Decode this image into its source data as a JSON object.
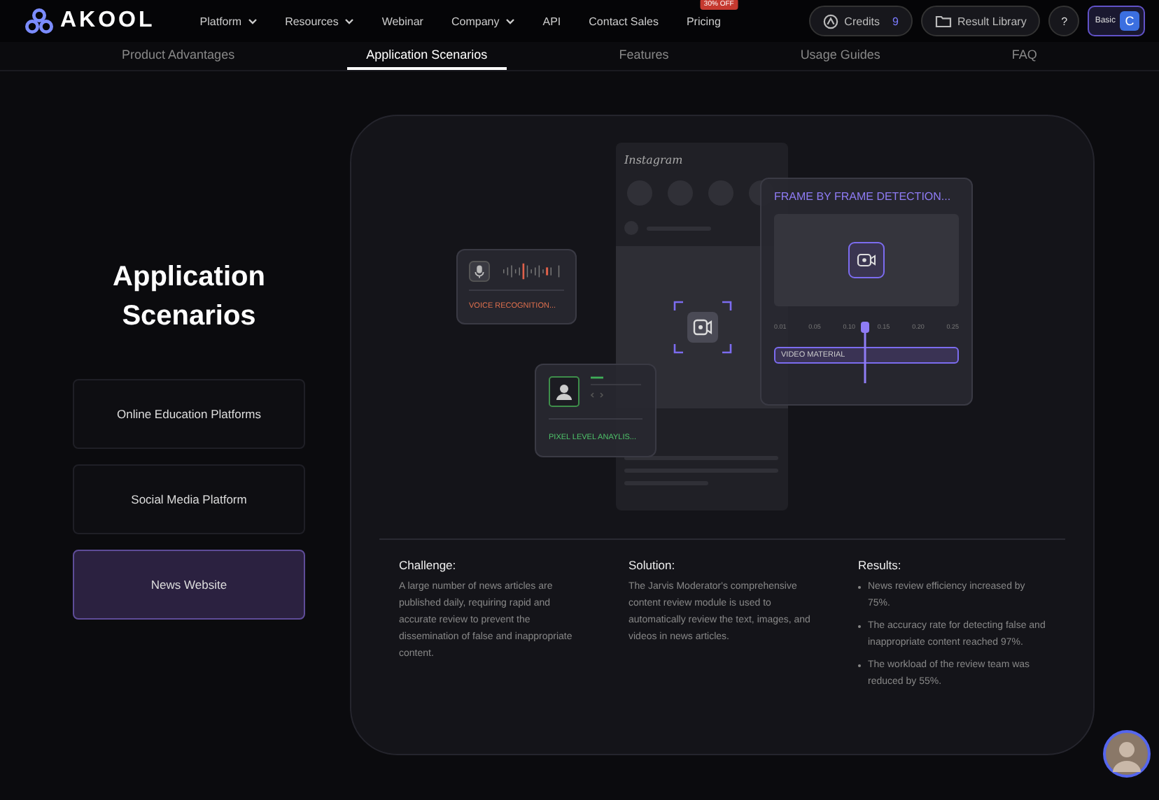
{
  "header": {
    "logo": "AKOOL",
    "nav": [
      {
        "label": "Platform",
        "dropdown": true
      },
      {
        "label": "Resources",
        "dropdown": true
      },
      {
        "label": "Webinar",
        "dropdown": false
      },
      {
        "label": "Company",
        "dropdown": true
      },
      {
        "label": "API",
        "dropdown": false
      },
      {
        "label": "Contact Sales",
        "dropdown": false
      },
      {
        "label": "Pricing",
        "dropdown": false,
        "badge": "30% OFF"
      }
    ],
    "credits": {
      "label": "Credits",
      "count": "9"
    },
    "result_library": "Result Library",
    "help": "?",
    "plan": {
      "label": "Basic",
      "avatar": "C"
    }
  },
  "tabs": [
    {
      "label": "Product Advantages",
      "selected": false
    },
    {
      "label": "Application Scenarios",
      "selected": true
    },
    {
      "label": "Features",
      "selected": false
    },
    {
      "label": "Usage Guides",
      "selected": false
    },
    {
      "label": "FAQ",
      "selected": false
    }
  ],
  "scenarios": {
    "title": "Application Scenarios",
    "items": [
      {
        "label": "Online Education Platforms",
        "selected": false
      },
      {
        "label": "Social Media Platform",
        "selected": false
      },
      {
        "label": "News Website",
        "selected": true
      }
    ]
  },
  "illustration": {
    "app_name": "Instagram",
    "voice_card": "VOICE RECOGNITION...",
    "pixel_card": "PIXEL LEVEL ANAYLIS...",
    "frame_card": {
      "title": "FRAME BY FRAME DETECTION...",
      "ticks": [
        "0.01",
        "0.05",
        "0.10",
        "0.15",
        "0.20",
        "0.25"
      ],
      "track_label": "VIDEO MATERIAL"
    }
  },
  "details": {
    "challenge": {
      "heading": "Challenge:",
      "text": "A large number of news articles are published daily, requiring rapid and accurate review to prevent the dissemination of false and inappropriate content."
    },
    "solution": {
      "heading": "Solution:",
      "text": "The Jarvis Moderator's comprehensive content review module is used to automatically review the text, images, and videos in news articles."
    },
    "results": {
      "heading": "Results:",
      "items": [
        "News review efficiency increased by 75%.",
        "The accuracy rate for detecting false and inappropriate content reached 97%.",
        "The workload of the review team was reduced by 55%."
      ]
    }
  }
}
